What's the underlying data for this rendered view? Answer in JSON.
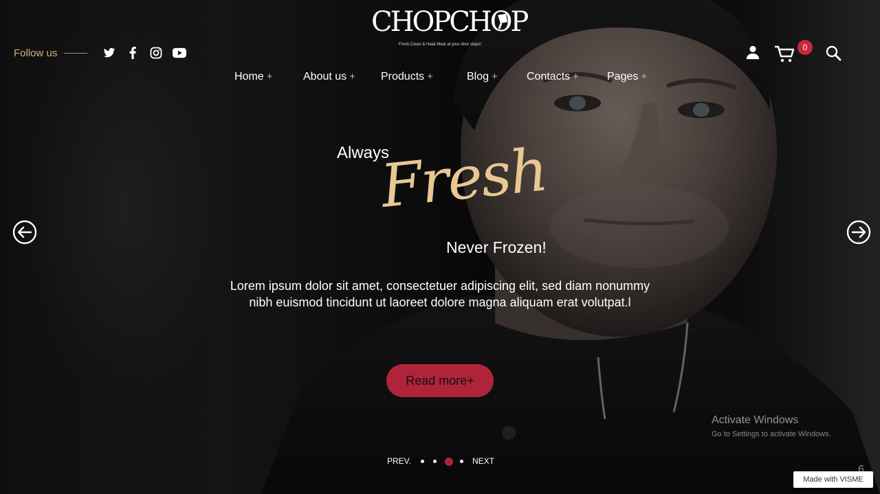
{
  "brand": {
    "logo_text": "CHOPCHOP",
    "tagline": "Fresh,Clean & Halal Meat at your door steps!"
  },
  "follow": {
    "label": "Follow us",
    "icons": [
      "twitter-icon",
      "facebook-icon",
      "instagram-icon",
      "youtube-icon"
    ]
  },
  "header": {
    "cart_count": "0",
    "icons": [
      "user-icon",
      "cart-icon",
      "search-icon"
    ]
  },
  "nav": {
    "items": [
      {
        "label": "Home",
        "plus": "+"
      },
      {
        "label": "About us",
        "plus": "+"
      },
      {
        "label": "Products",
        "plus": "+"
      },
      {
        "label": "Blog",
        "plus": "+"
      },
      {
        "label": "Contacts",
        "plus": "+"
      },
      {
        "label": "Pages",
        "plus": "+"
      }
    ]
  },
  "hero": {
    "line1": "Always",
    "script": "Fresh",
    "line2": "Never Frozen!",
    "description": "Lorem ipsum dolor sit amet, consectetuer adipiscing elit, sed diam nonummy nibh euismod tincidunt ut laoreet dolore magna aliquam erat volutpat.l",
    "cta": "Read more+"
  },
  "slider": {
    "prev_label": "PREV.",
    "next_label": "NEXT",
    "dot_count": 4,
    "active_dot": 3
  },
  "windows_notice": {
    "title": "Activate Windows",
    "subtitle": "Go to Settings to activate Windows.",
    "corner": "6"
  },
  "badge": {
    "visme": "Made with VISME"
  },
  "colors": {
    "accent_gold": "#d6b07a",
    "script_gold": "#e8c793",
    "cta_red": "#b0243a",
    "badge_red": "#c8283a"
  }
}
